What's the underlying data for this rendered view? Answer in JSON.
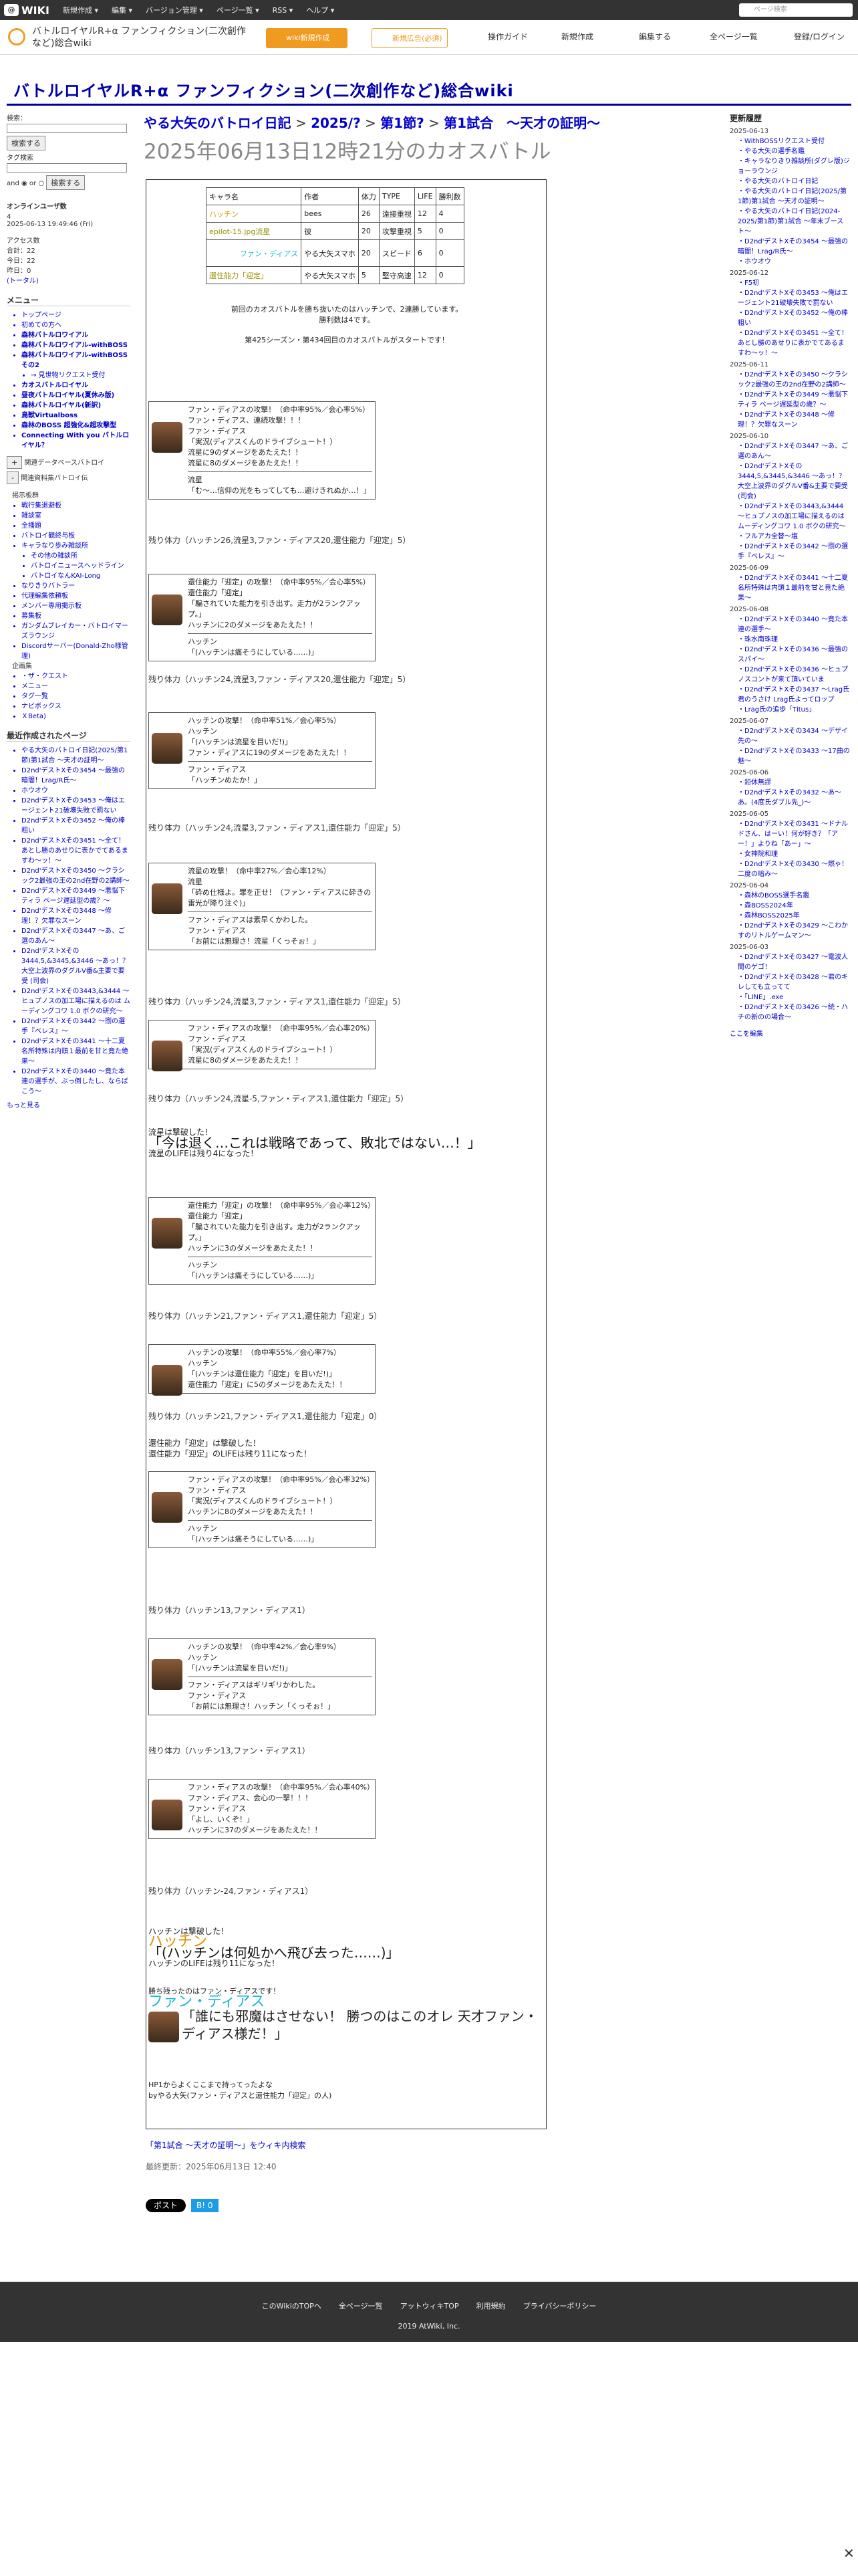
{
  "topbar": {
    "logo": "WIKI",
    "menus": [
      "新規作成 ▾",
      "編集 ▾",
      "バージョン管理 ▾",
      "ページ一覧 ▾",
      "RSS ▾",
      "ヘルプ ▾"
    ],
    "search_placeholder": "ページ検索"
  },
  "header": {
    "site_name": "バトルロイヤルR+α ファンフィクション(二次創作など)総合wiki",
    "btn_new": "wiki新規作成",
    "btn_ad": "新規広告(必須)",
    "links": [
      "操作ガイド",
      "新規作成",
      "編集する",
      "全ページ一覧",
      "登録/ログイン"
    ]
  },
  "wiki_title": "バトルロイヤルR+α ファンフィクション(二次創作など)総合wiki",
  "left": {
    "search_label": "検索：",
    "search_button": "検索する",
    "tag_label": "タグ検索",
    "and": "and",
    "or": "or",
    "search_button2": "検索する",
    "online_title": "オンラインユーザ数",
    "online_count": "4",
    "date": "2025-06-13 19:49:46 (Fri)",
    "access_title": "アクセス数",
    "access": [
      "合計：22",
      "今日：22",
      "昨日：0"
    ],
    "total_label": "(トータル)",
    "menu_title": "メニュー",
    "menu": [
      "トップページ",
      "初めての方へ",
      "森林バトルロワイアル",
      "森林バトルロワイアル-withBOSS",
      "森林バトルロワイアル-withBOSS その2",
      "→ 見世物リクエスト受付",
      "カオスバトルロイヤル",
      "昼夜バトルロイヤル(夏休み版)",
      "森林バトルロイヤル(新訳)",
      "鳥獣Virtualboss",
      "森林のBOSS 超強化&超攻撃型",
      "Connecting With you バトルロイヤル？"
    ],
    "small_btns": [
      "+",
      "-"
    ],
    "small_labels": [
      "関連データベースバトロイ",
      "関連資料集バトロイ伝"
    ],
    "sub_title": "掲示板群",
    "sub": [
      "戦行集退避板",
      "雑談室",
      "全播題",
      "バトロイ観終与板",
      "キャラなり歩み雑談所",
      "その他の雑談所",
      "バトロイニュースへッドライン",
      "バトロイなんKAI-Long",
      "なりきりバトラー",
      "代理編集依頼板",
      "メンバー専用掲示板",
      "募集板",
      "ガンダムブレイカー・バトロイマーズラウンジ",
      "Discordサーバー(Donald-Zho様管理)"
    ],
    "enterprise_title": "企画集",
    "enterprise": [
      "・ザ・クエスト"
    ],
    "misc": [
      "メニュー",
      "タグ一覧",
      "ナビボックス",
      "ＸBeta)"
    ],
    "recent_title": "最近作成されたページ",
    "recent": [
      "やる大矢のバトロイ日記(2025/第1節)第1試合 〜天才の証明〜",
      "D2nd'デストXその3454 〜最強の暗闇！Lrag/R氏〜",
      "ホウオウ",
      "D2nd'デストXその3453 〜俺はエージェント21破壊失敗で罰ない",
      "D2nd'デストXその3452 〜俺の棒粗い",
      "D2nd'デストXその3451 〜全て！あとし勝のあせりに表かでてあるますわ〜ッ！〜",
      "D2nd'デストXその3450 〜クラシック2最強の王の2nd在野の2講師〜",
      "D2nd'デストXその3449 〜悪悩下ティラ ページ遅延型の歳？〜",
      "D2nd'デストXその3448 〜修理！？欠罪なスーン",
      "D2nd'デストXその3447 〜あ、ご選のあん〜",
      "D2nd'デストXその3444,5,&3445,&3446 〜あっ！？大空上波界のダグルV番&主要で要受 (司会)",
      "D2nd'デストXその3443,&3444 〜ヒュプノスの加工場に描えるのは ムーディングコワ 1.0 ボクの研究〜",
      "D2nd'デストXその3442 〜捌の選手『ベレス』〜",
      "D2nd'デストXその3441 〜十二夏名所特殊は内頭１最前を甘と竟た絶果〜",
      "D2nd'デストXその3440 〜竟た本連の選手が、ぶっ倒したし、ならばこう〜"
    ],
    "more": "もっと見る"
  },
  "main": {
    "breadcrumb": [
      "やる大矢のバトロイ日記",
      "2025/?",
      "第1節?",
      "第1試合　〜天才の証明〜"
    ],
    "title": "2025年06月13日12時21分のカオスバトル",
    "table_headers": [
      "キャラ名",
      "作者",
      "体力",
      "TYPE",
      "LIFE",
      "勝利数"
    ],
    "table_rows": [
      [
        "ハッチン",
        "bees",
        "26",
        "遠接重視",
        "12",
        "4"
      ],
      [
        "epilot-15.jpg流星",
        "彼",
        "20",
        "攻撃重視",
        "5",
        "0"
      ],
      [
        "ファン・ディアス",
        "やる大矢スマホ",
        "20",
        "スピード",
        "6",
        "0"
      ],
      [
        "還住能力「迎定」",
        "やる大矢スマホ",
        "5",
        "堅守高速",
        "12",
        "0"
      ]
    ],
    "intro": [
      "前回のカオスバトルを勝ち抜いたのはハッチンで、2連勝しています。",
      "勝利数は4です。",
      "第425シーズン・第434回目のカオスバトルがスタートです！"
    ],
    "logs": [
      {
        "lines": [
          "ファン・ディアスの攻撃！（命中率95%／会心率5%）",
          "ファン・ディアス、連続攻撃！！！",
          "ファン・ディアス",
          "「実況(ディアスくんのドライブシュート！）",
          "流星に9のダメージをあたえた！！",
          "流星に8のダメージをあたえた！！"
        ],
        "lines2": [
          "流星",
          "「む〜…信仰の光をもってしても…避けきれぬか…！」"
        ]
      },
      {
        "hp": "残り体力（ハッチン26,流星3,ファン・ディアス20,還住能力「迎定」5）"
      },
      {
        "lines": [
          "還住能力「迎定」の攻撃！（命中率95%／会心率5%）",
          "還住能力「迎定」",
          "「騙されていた能力を引き出す。走力が2ランクアップ。」",
          "ハッチンに2のダメージをあたえた！！"
        ],
        "lines2": [
          "ハッチン",
          "「(ハッチンは痛そうにしている……)」"
        ]
      },
      {
        "hp": "残り体力（ハッチン24,流星3,ファン・ディアス20,還住能力「迎定」5）"
      },
      {
        "lines": [
          "ハッチンの攻撃！（命中率51%／会心率5%）",
          "ハッチン",
          "「(ハッチンは流星を目いだ!)」",
          "ファン・ディアスに19のダメージをあたえた！！"
        ],
        "lines2": [
          "ファン・ディアス",
          "「ハッチンめたか！」"
        ]
      },
      {
        "hp": "残り体力（ハッチン24,流星3,ファン・ディアス1,還住能力「迎定」5）"
      },
      {
        "lines": [
          "流星の攻撃！（命中率27%／会心率12%）",
          "流星",
          "「砕め仕様よ。罪を正せ！（ファン・ディアスに砕きの雷光が降り注ぐ)」"
        ],
        "lines2": [
          "ファン・ディアスは素早くかわした。",
          "ファン・ディアス",
          "「お前には無理さ！流星「くっそぉ！」"
        ]
      },
      {
        "hp": "残り体力（ハッチン24,流星3,ファン・ディアス1,還住能力「迎定」5）"
      },
      {
        "lines": [
          "ファン・ディアスの攻撃！（命中率95%／会心率20%）",
          "ファン・ディアス",
          "「実況(ディアスくんのドライブシュート！）",
          "流星に8のダメージをあたえた！！"
        ]
      },
      {
        "hp": "残り体力（ハッチン24,流星-5,ファン・ディアス1,還住能力「迎定」5）"
      },
      {
        "ko": [
          "流星は撃破した！",
          "「今は退く…これは戦略であって、敗北ではない…！」",
          "流星のLIFEは残り4になった！"
        ]
      },
      {
        "lines": [
          "還住能力「迎定」の攻撃！（命中率95%／会心率12%）",
          "還住能力「迎定」",
          "「騙されていた能力を引き出す。走力が2ランクアップ。」",
          "ハッチンに3のダメージをあたえた！！"
        ],
        "lines2": [
          "ハッチン",
          "「(ハッチンは痛そうにしている……)」"
        ]
      },
      {
        "hp": "残り体力（ハッチン21,ファン・ディアス1,還住能力「迎定」5）"
      },
      {
        "lines": [
          "ハッチンの攻撃！（命中率55%／会心率7%）",
          "ハッチン",
          "「(ハッチンは還住能力「迎定」を目いだ!)」",
          "還住能力「迎定」に5のダメージをあたえた！！"
        ]
      },
      {
        "hp": "残り体力（ハッチン21,ファン・ディアス1,還住能力「迎定」0）"
      },
      {
        "ko": [
          "還住能力「迎定」は撃破した！",
          "還住能力「迎定」のLIFEは残り11になった！"
        ]
      },
      {
        "lines": [
          "ファン・ディアスの攻撃！（命中率95%／会心率32%）",
          "ファン・ディアス",
          "「実況(ディアスくんのドライブシュート！）",
          "ハッチンに8のダメージをあたえた！！"
        ],
        "lines2": [
          "ハッチン",
          "「(ハッチンは痛そうにしている……)」"
        ]
      },
      {
        "hp": "残り体力（ハッチン13,ファン・ディアス1）"
      },
      {
        "lines": [
          "ハッチンの攻撃！（命中率42%／会心率9%）",
          "ハッチン",
          "「(ハッチンは流星を目いだ!)」"
        ],
        "lines2": [
          "ファン・ディアスはギリギリかわした。",
          "ファン・ディアス",
          "「お前には無理さ！ハッチン「くっそぉ！」"
        ]
      },
      {
        "hp": "残り体力（ハッチン13,ファン・ディアス1）"
      },
      {
        "lines": [
          "ファン・ディアスの攻撃！（命中率95%／会心率40%）",
          "ファン・ディアス、会心の一撃！！！",
          "ファン・ディアス",
          "「よし、いくぞ！」",
          "ハッチンに37のダメージをあたえた！！"
        ]
      },
      {
        "hp": "残り体力（ハッチン-24,ファン・ディアス1）"
      },
      {
        "ko": [
          "ハッチンは撃破した！",
          "ハッチン",
          "「(ハッチンは何処かへ飛び去った……)」",
          "ハッチンのLIFEは残り11になった！"
        ]
      },
      {
        "win": [
          "勝ち残ったのはファン・ディアスです！",
          "ファン・ディアス",
          "「誰にも邪魔はさせない！ 勝つのはこのオレ 天才ファン・ディアス様だ！」"
        ]
      },
      {
        "foot": [
          "HP1からよくここまで持ってったよな",
          "byやる大矢(ファン・ディアスと還住能力「迎定」の人)"
        ]
      }
    ],
    "similar": "「第1試合 〜天才の証明〜」をウィキ内検索",
    "updated": "最終更新：2025年06月13日 12:40",
    "share": [
      "ポスト",
      "B! 0"
    ]
  },
  "right": {
    "title": "更新履歴",
    "groups": [
      {
        "date": "2025-06-13",
        "items": [
          "WithBOSSリクエスト受付",
          "やる大矢の選手名鑑",
          "キャラなりきり雑談所(ダグレ版)ジョーラウンジ",
          "やる大矢のバトロイ日記",
          "やる大矢のバトロイ日記(2025/第1節)第1試合 〜天才の証明〜",
          "やる大矢のバトロイ日記(2024-2025/第1節)第1試合 〜年末ブースト〜",
          "D2nd'デストXその3454 〜最強の暗闇！Lrag/R氏〜",
          "ホウオウ"
        ]
      },
      {
        "date": "2025-06-12",
        "items": [
          "F5初",
          "D2nd'デストXその3453 〜俺はエージェント21破壊失敗で罰ない",
          "D2nd'デストXその3452 〜俺の棒粗い",
          "D2nd'デストXその3451 〜全て！あとし勝のあせりに表かでてあるますわ〜ッ！〜"
        ]
      },
      {
        "date": "2025-06-11",
        "items": [
          "D2nd'デストXその3450 〜クラシック2最強の王の2nd在野の2講師〜",
          "D2nd'デストXその3449 〜悪悩下ティラ ページ遅延型の歳？〜",
          "D2nd'デストXその3448 〜修理！？欠罪なスーン"
        ]
      },
      {
        "date": "2025-06-10",
        "items": [
          "D2nd'デストXその3447 〜あ、ご選のあん〜",
          "D2nd'デストXその3444,5,&3445,&3446 〜あっ！？大空上波界のダグルV番&主要で要受 (司会)",
          "D2nd'デストXその3443,&3444 〜ヒュプノスの加工場に描えるのは ムーディングコワ 1.0 ボクの研究〜",
          "フルアカ全替〜塩",
          "D2nd'デストXその3442 〜捌の選手『ベレス』〜"
        ]
      },
      {
        "date": "2025-06-09",
        "items": [
          "D2nd'デストXその3441 〜十二夏名所特殊は内頭１最前を甘と竟た絶果〜"
        ]
      },
      {
        "date": "2025-06-08",
        "items": [
          "D2nd'デストXその3440 〜竟た本連の選手〜",
          "珠水南珠理",
          "D2nd'デストXその3436 〜最強のスパイ〜",
          "D2nd'デストXその3436 〜ヒュプノスコントが来て頂いていま",
          "D2nd'デストXその3437 〜Lrag氏君のうさけ Lrag氏よってロップ",
          "Lrag氏の追歩「Titus」"
        ]
      },
      {
        "date": "2025-06-07",
        "items": [
          "D2nd'デストXその3434 〜デザイ先の〜",
          "D2nd'デストXその3433 〜17曲の魅〜"
        ]
      },
      {
        "date": "2025-06-06",
        "items": [
          "鉛休無謬",
          "D2nd'デストXその3432 〜あ〜あ。(4度氏ダブル先_)〜"
        ]
      },
      {
        "date": "2025-06-05",
        "items": [
          "D2nd'デストXその3431 〜ドナルドさん、はーい！何が好き？「アー！」よりね「あー」〜",
          "女神院和理",
          "D2nd'デストXその3430 〜燃ゃ！二度の暗み〜"
        ]
      },
      {
        "date": "2025-06-04",
        "items": [
          "森林のBOSS選手名鑑",
          "森BOSS2024年",
          "森林BOSS2025年",
          "D2nd'デストXその3429 〜こわかすのリトルゲームマン〜"
        ]
      },
      {
        "date": "2025-06-03",
        "items": [
          "D2nd'デストXその3427 〜電波人間のゲゴ！",
          "D2nd'デストXその3428 〜君のキレしても立ってて",
          "「LINE」.exe",
          "D2nd'デストXその3426 〜続・ハチの新のの場合〜"
        ]
      }
    ],
    "more": "ここを編集"
  },
  "footer": {
    "links": [
      "このWikiのTOPへ",
      "全ページ一覧",
      "アットウィキTOP",
      "利用規約",
      "プライバシーポリシー"
    ],
    "copy": "2019 AtWiki, Inc."
  }
}
